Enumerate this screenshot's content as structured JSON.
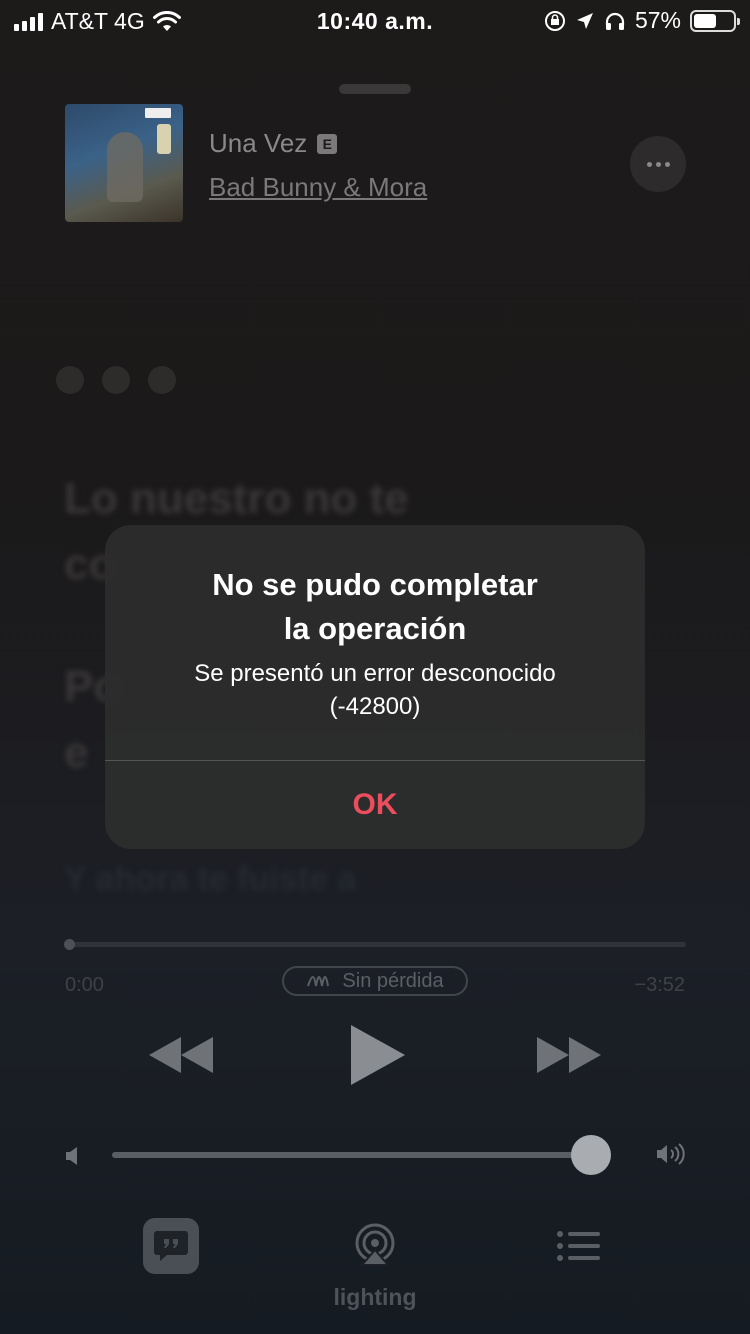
{
  "status_bar": {
    "carrier": "AT&T 4G",
    "time": "10:40 a.m.",
    "battery_percent": "57%",
    "battery_level": 0.57
  },
  "now_playing": {
    "title": "Una Vez",
    "explicit_badge": "E",
    "artist": "Bad Bunny & Mora",
    "album_art_icon": "album-cover-image"
  },
  "lyrics": {
    "line1": "Lo nuestro no te",
    "line2": "co",
    "line3": "Po",
    "line4": "e",
    "line5": "Y ahora te fuiste a"
  },
  "playback": {
    "elapsed": "0:00",
    "remaining": "−3:52",
    "lossless_label": "Sin pérdida",
    "progress": 0.0,
    "volume": 0.97
  },
  "bottom": {
    "airplay_label": "lighting"
  },
  "alert": {
    "title_line1": "No se pudo completar",
    "title_line2": "la operación",
    "message_line1": "Se presentó un error desconocido",
    "message_line2": "(-42800)",
    "ok_label": "OK",
    "ok_color": "#eb4d5c"
  }
}
